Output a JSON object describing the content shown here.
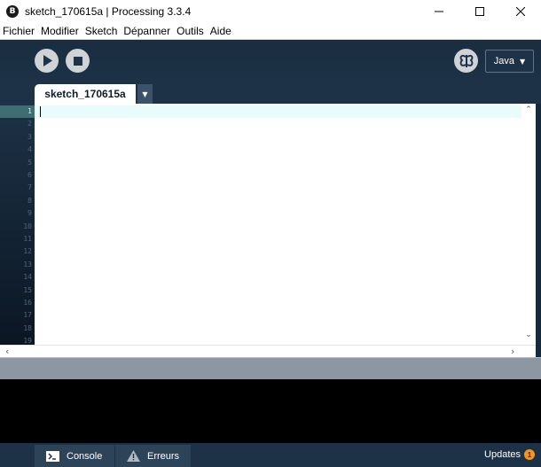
{
  "window": {
    "logo_icon": "processing-logo-icon",
    "logo_char": "B",
    "title": "sketch_170615a | Processing 3.3.4",
    "controls": [
      "minimize-icon",
      "maximize-icon",
      "close-icon"
    ]
  },
  "menu": {
    "items": [
      {
        "label": "Fichier"
      },
      {
        "label": "Modifier"
      },
      {
        "label": "Sketch"
      },
      {
        "label": "Dépanner"
      },
      {
        "label": "Outils"
      },
      {
        "label": "Aide"
      }
    ]
  },
  "toolbar": {
    "run_icon": "play-icon",
    "stop_icon": "stop-icon",
    "debug_icon": "debugger-butterfly-icon",
    "mode_label": "Java",
    "mode_caret": "▼"
  },
  "tabs": {
    "items": [
      {
        "label": "sketch_170615a"
      }
    ],
    "menu_caret": "▼"
  },
  "editor": {
    "line_numbers": [
      "1",
      "2",
      "3",
      "4",
      "5",
      "6",
      "7",
      "8",
      "9",
      "10",
      "11",
      "12",
      "13",
      "14",
      "15",
      "16",
      "17",
      "18",
      "19"
    ],
    "current_line": 1
  },
  "footer": {
    "console_label": "Console",
    "console_icon": "terminal-icon",
    "errors_label": "Erreurs",
    "errors_icon": "warning-icon",
    "updates_label": "Updates",
    "updates_count": "1"
  },
  "colors": {
    "toolbar_bg": "#1d3246",
    "current_line": "#e7fcfb",
    "badge": "#f7941d"
  }
}
